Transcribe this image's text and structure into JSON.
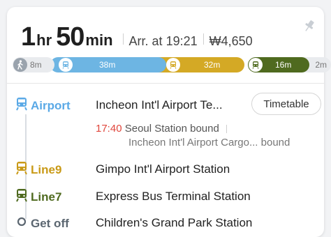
{
  "summary": {
    "hours": "1",
    "hours_unit": "hr",
    "minutes": "50",
    "minutes_unit": "min",
    "arrival": "Arr. at 19:21",
    "fare": "₩4,650"
  },
  "bar": {
    "walk_start": "8m",
    "seg_airport": "38m",
    "seg_line9": "32m",
    "seg_line7": "16m",
    "walk_end": "2m"
  },
  "steps": [
    {
      "label": "Airport",
      "station": "Incheon Int'l Airport Te...",
      "color": "#5aa9e6"
    },
    {
      "label": "Line9",
      "station": "Gimpo Int'l Airport Station",
      "color": "#c99a17"
    },
    {
      "label": "Line7",
      "station": "Express Bus Terminal Station",
      "color": "#4f6a1f"
    },
    {
      "label": "Get off",
      "station": "Children's Grand Park Station",
      "color": "#5b6670"
    }
  ],
  "timetable_label": "Timetable",
  "departure": {
    "time": "17:40",
    "direction": "Seoul Station bound",
    "next": "Incheon Int'l Airport Cargo... bound"
  },
  "colors": {
    "airport": "#6db5e3",
    "line9": "#d4a925",
    "line7": "#4f6a1f",
    "accent_red": "#e0463c"
  },
  "icons": [
    "pin-icon",
    "walk-icon",
    "train-icon"
  ]
}
